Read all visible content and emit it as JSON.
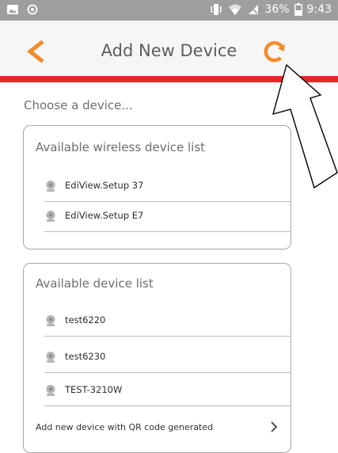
{
  "status_bar": {
    "battery_percent": "36%",
    "time": "9:43"
  },
  "app_bar": {
    "title": "Add New Device",
    "accent_color": "#f28c28"
  },
  "header_bar_color": "#e8272c",
  "prompt": "Choose a device...",
  "wireless_section": {
    "title": "Available wireless device list",
    "items": [
      "EdiView.Setup 37",
      "EdiView.Setup E7"
    ]
  },
  "device_section": {
    "title": "Available device list",
    "items": [
      "test6220",
      "test6230",
      "TEST-3210W"
    ],
    "qr_action": "Add new device with QR code generated"
  }
}
